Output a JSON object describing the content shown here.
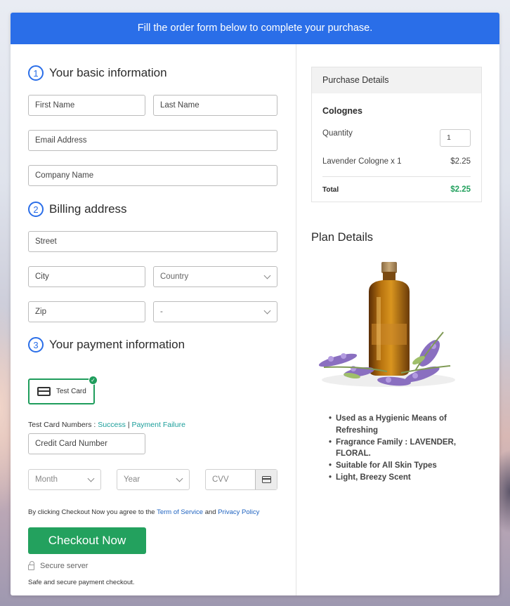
{
  "banner": {
    "text": "Fill the order form below to complete your purchase."
  },
  "sections": {
    "basic": {
      "number": "1",
      "title": "Your basic information"
    },
    "billing": {
      "number": "2",
      "title": "Billing address"
    },
    "payment": {
      "number": "3",
      "title": "Your payment information"
    }
  },
  "fields": {
    "first_name": "First Name",
    "last_name": "Last Name",
    "email": "Email Address",
    "company": "Company Name",
    "street": "Street",
    "city": "City",
    "country": "Country",
    "zip": "Zip",
    "state": "-",
    "card_number": "Credit Card Number",
    "month": "Month",
    "year": "Year",
    "cvv": "CVV"
  },
  "payment": {
    "method_label": "Test Card",
    "check": "✓",
    "test_numbers_label": "Test Card Numbers :",
    "success_link": "Success",
    "separator": "|",
    "failure_link": "Payment Failure"
  },
  "terms": {
    "prefix": "By clicking Checkout Now you agree to the",
    "tos": "Term of Service",
    "and": "and",
    "privacy": "Privacy Policy"
  },
  "checkout": {
    "button": "Checkout Now",
    "secure": "Secure server",
    "safe_text": "Safe and secure payment checkout."
  },
  "purchase": {
    "header": "Purchase Details",
    "product_group": "Colognes",
    "quantity_label": "Quantity",
    "quantity_value": "1",
    "item": "Lavender Cologne x 1",
    "item_price": "$2.25",
    "total_label": "Total",
    "total_value": "$2.25"
  },
  "plan": {
    "title": "Plan Details",
    "features": [
      "Used as a Hygienic Means of Refreshing",
      "Fragrance Family : LAVENDER, FLORAL.",
      "Suitable for All Skin Types",
      "Light, Breezy Scent"
    ]
  },
  "colors": {
    "accent_blue": "#2a6ee8",
    "button_green": "#23a15e",
    "total_green": "#23a15e"
  }
}
